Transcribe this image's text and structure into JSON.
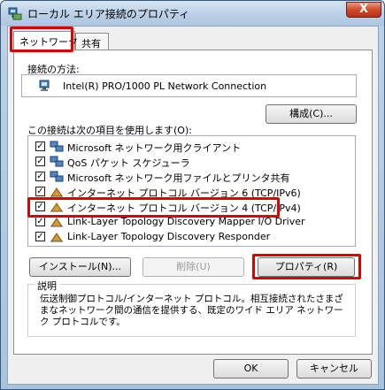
{
  "window": {
    "title": "ローカル エリア接続のプロパティ",
    "close_label": "X"
  },
  "tabs": [
    {
      "label": "ネットワーク",
      "active": true
    },
    {
      "label": "共有",
      "active": false
    }
  ],
  "connection": {
    "label": "接続の方法:",
    "adapter_name": "Intel(R) PRO/1000 PL Network Connection",
    "configure_button": "構成(C)..."
  },
  "items_section": {
    "label": "この接続は次の項目を使用します(O):",
    "items": [
      {
        "label": "Microsoft ネットワーク用クライアント",
        "checked": true,
        "icon": "network-client-icon"
      },
      {
        "label": "QoS パケット スケジューラ",
        "checked": true,
        "icon": "qos-scheduler-icon"
      },
      {
        "label": "Microsoft ネットワーク用ファイルとプリンタ共有",
        "checked": true,
        "icon": "file-printer-sharing-icon"
      },
      {
        "label": "インターネット プロトコル バージョン 6 (TCP/IPv6)",
        "checked": true,
        "icon": "protocol-icon"
      },
      {
        "label": "インターネット プロトコル バージョン 4 (TCP/IPv4)",
        "checked": true,
        "icon": "protocol-icon"
      },
      {
        "label": "Link-Layer Topology Discovery Mapper I/O Driver",
        "checked": true,
        "icon": "protocol-icon"
      },
      {
        "label": "Link-Layer Topology Discovery Responder",
        "checked": true,
        "icon": "protocol-icon"
      }
    ]
  },
  "buttons": {
    "install": "インストール(N)...",
    "uninstall": "削除(U)",
    "properties": "プロパティ(R)"
  },
  "description": {
    "legend": "説明",
    "text": "伝送制御プロトコル/インターネット プロトコル。相互接続されたさまざまなネットワーク間の通信を提供する、既定のワイド エリア ネットワーク プロトコルです。"
  },
  "dialog_buttons": {
    "ok": "OK",
    "cancel": "キャンセル"
  },
  "colors": {
    "highlight": "#e00000",
    "title_bar": "#b9cfe6"
  }
}
